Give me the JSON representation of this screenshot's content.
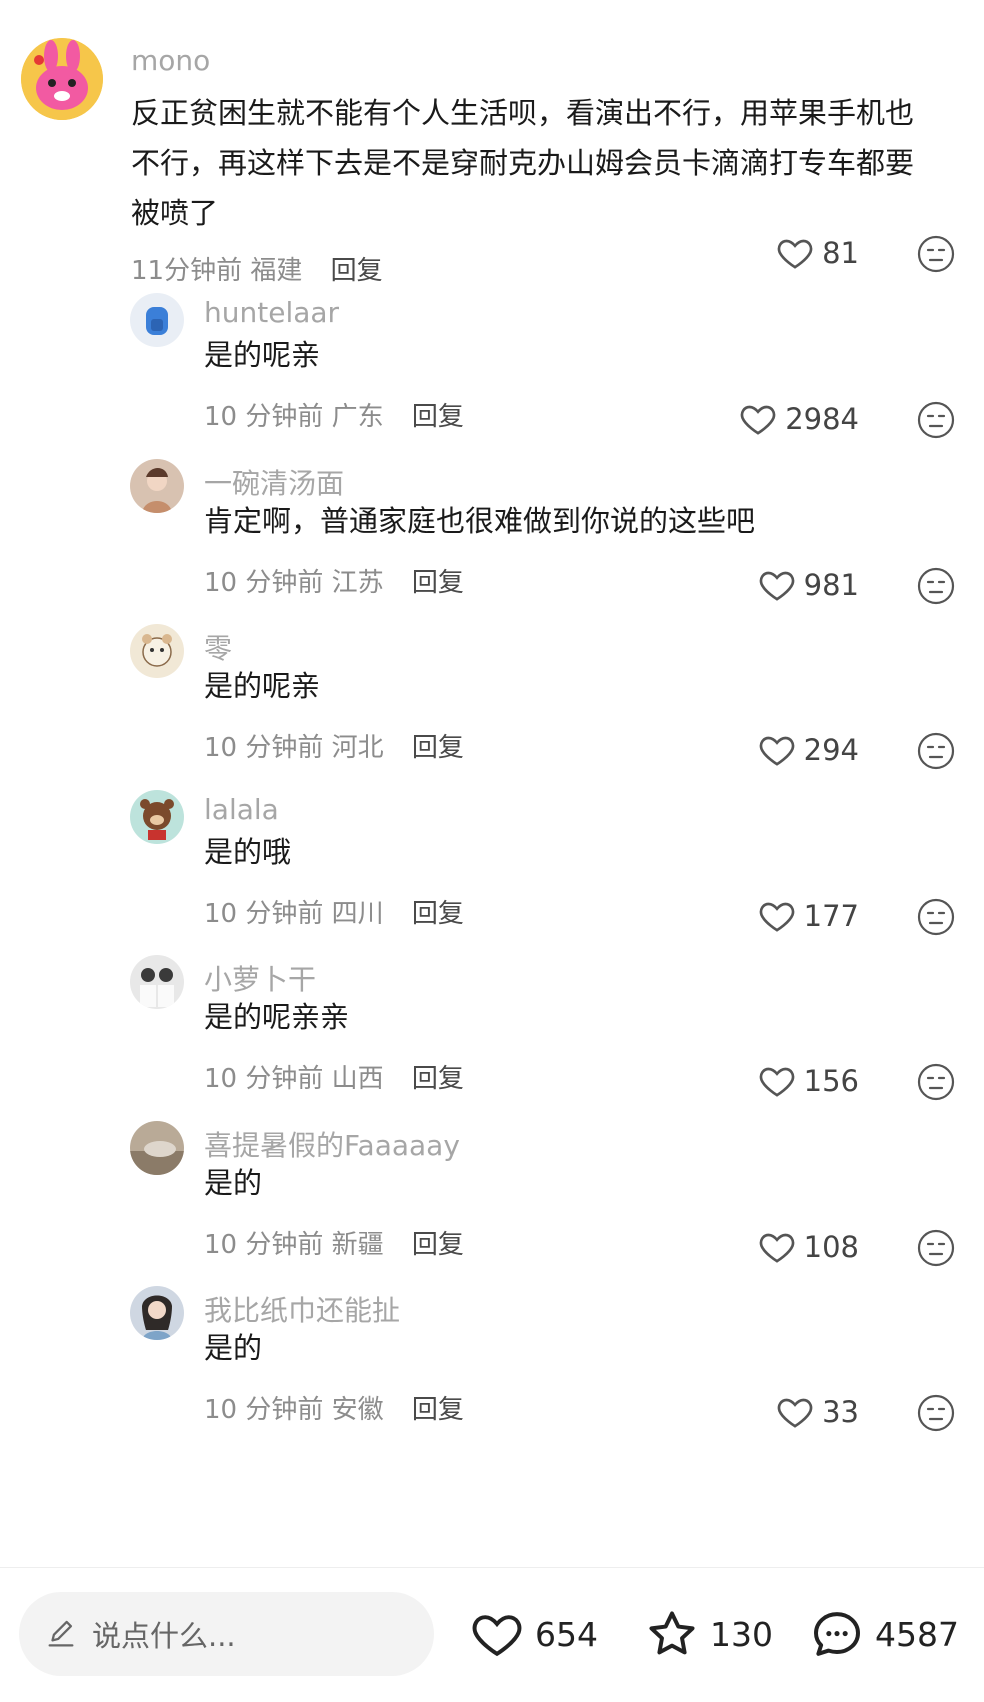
{
  "comments": [
    {
      "user": "mono",
      "text": "反正贫困生就不能有个人生活呗，看演出不行，用苹果手机也不行，再这样下去是不是穿耐克办山姆会员卡滴滴打专车都要被喷了",
      "time": "11分钟前",
      "location": "福建",
      "reply_label": "回复",
      "likes": "81",
      "avatar_icon": "pink-bunny-avatar"
    }
  ],
  "replies": [
    {
      "user": "huntelaar",
      "text": "是的呢亲",
      "time": "10 分钟前",
      "location": "广东",
      "reply_label": "回复",
      "likes": "2984",
      "avatar_icon": "blue-hoodie-avatar"
    },
    {
      "user": "一碗清汤面",
      "text": "肯定啊，普通家庭也很难做到你说的这些吧",
      "time": "10 分钟前",
      "location": "江苏",
      "reply_label": "回复",
      "likes": "981",
      "avatar_icon": "girl-photo-avatar"
    },
    {
      "user": "零",
      "text": "是的呢亲",
      "time": "10 分钟前",
      "location": "河北",
      "reply_label": "回复",
      "likes": "294",
      "avatar_icon": "bear-sticker-avatar"
    },
    {
      "user": "lalala",
      "text": "是的哦",
      "time": "10 分钟前",
      "location": "四川",
      "reply_label": "回复",
      "likes": "177",
      "avatar_icon": "brown-bear-avatar"
    },
    {
      "user": "小萝卜干",
      "text": "是的呢亲亲",
      "time": "10 分钟前",
      "location": "山西",
      "reply_label": "回复",
      "likes": "156",
      "avatar_icon": "two-people-photo-avatar"
    },
    {
      "user": "喜提暑假的Faaaaay",
      "text": "是的",
      "time": "10 分钟前",
      "location": "新疆",
      "reply_label": "回复",
      "likes": "108",
      "avatar_icon": "landscape-photo-avatar"
    },
    {
      "user": "我比纸巾还能扯",
      "text": "是的",
      "time": "10 分钟前",
      "location": "安徽",
      "reply_label": "回复",
      "likes": "33",
      "avatar_icon": "girl-portrait-avatar"
    }
  ],
  "bottom_bar": {
    "input_placeholder": "说点什么...",
    "likes": "654",
    "favorites": "130",
    "comments": "4587"
  }
}
